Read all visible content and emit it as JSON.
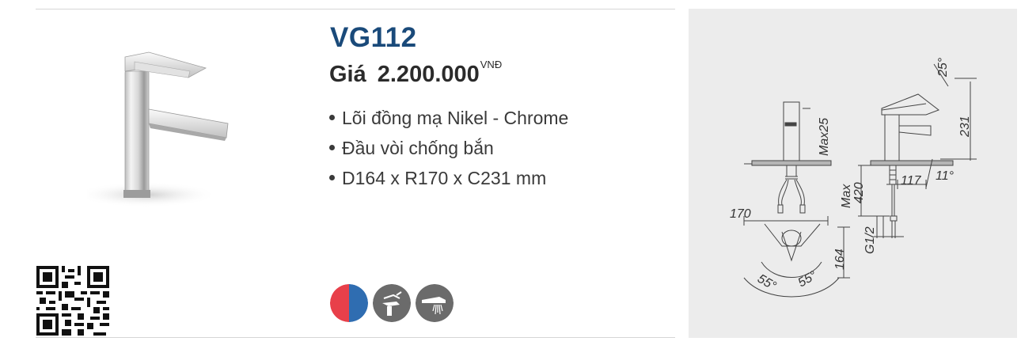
{
  "product": {
    "model": "VG112",
    "price_label": "Giá",
    "price_value": "2.200.000",
    "currency": "VNĐ",
    "features": [
      "Lõi đồng mạ Nikel - Chrome",
      "Đầu vòi chống bắn",
      "D164 x R170 x C231 mm"
    ]
  },
  "feature_icons": [
    "hot-cold-water-icon",
    "single-lever-icon",
    "anti-splash-aerator-icon"
  ],
  "colors": {
    "model_blue": "#1a4a7a",
    "hot_red": "#e8404a",
    "cold_blue": "#2f6db1",
    "icon_gray": "#6b6b6b",
    "panel_gray": "#ececec"
  },
  "technical_drawing": {
    "dimensions": {
      "height": "231",
      "lever_angle": "25°",
      "spout_angle": "11°",
      "spout_reach": "117",
      "max_deck": "Max25",
      "max_hose": "Max",
      "hose_length": "420",
      "connection": "G1/2",
      "width": "170",
      "depth": "164",
      "rotation_left": "55°",
      "rotation_right": "55°"
    }
  }
}
